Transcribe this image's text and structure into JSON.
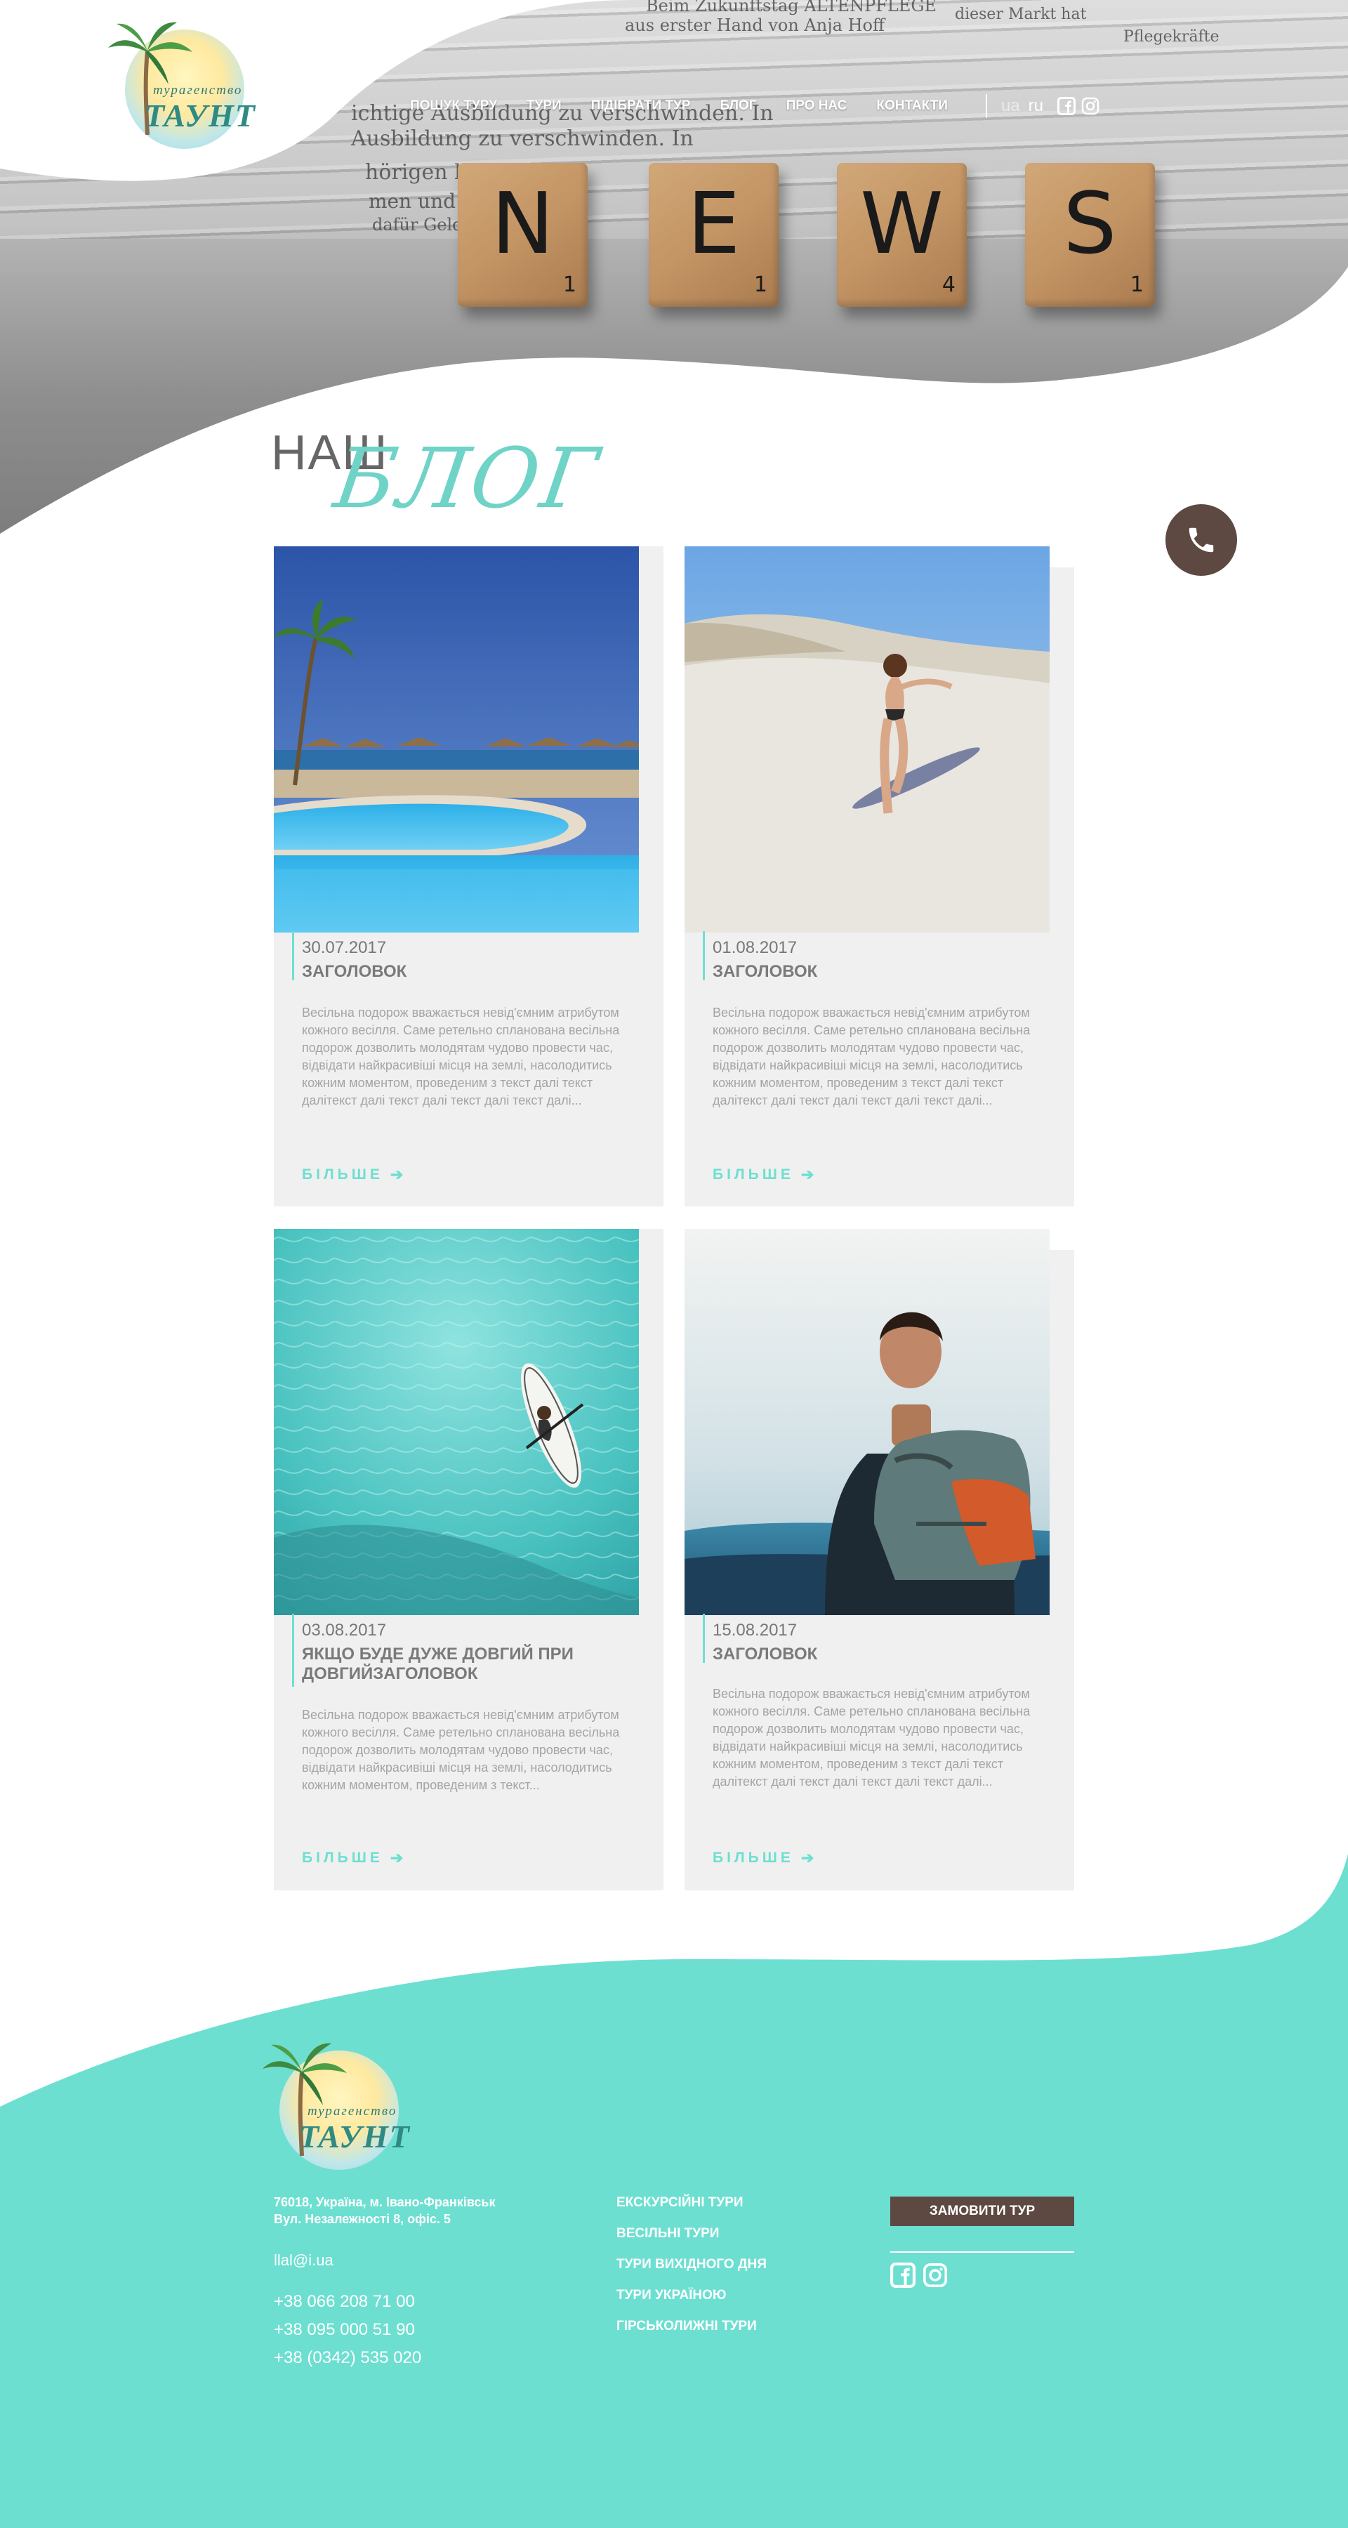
{
  "brand": {
    "logo_small_text": "турагенство",
    "logo_name": "ТАУНТ",
    "accent_color": "#6ddfd1",
    "dark_color": "#5e4942"
  },
  "nav": {
    "items": [
      {
        "label": "ПОШУК ТУРУ"
      },
      {
        "label": "ТУРИ"
      },
      {
        "label": "ПІДІБРАТИ ТУР"
      },
      {
        "label": "БЛОГ"
      },
      {
        "label": "ПРО НАС"
      },
      {
        "label": "КОНТАКТИ"
      }
    ],
    "lang_ua": "ua",
    "lang_ru": "ru",
    "icons": [
      "facebook-icon",
      "instagram-icon"
    ]
  },
  "hero": {
    "tiles": [
      {
        "letter": "N",
        "score": "1"
      },
      {
        "letter": "E",
        "score": "1"
      },
      {
        "letter": "W",
        "score": "4"
      },
      {
        "letter": "S",
        "score": "1"
      }
    ],
    "paper_lines": [
      "Beim Zukunftstag ALTENPFLEGE",
      "aus erster Hand von Anja Hoff",
      "dieser Markt hat",
      "Pflegekräfte",
      "ichtige Ausbildung zu verschwinden. In",
      "Ausbildung zu verschwinden. In",
      "hörigen belasten",
      "men und Ausbildung",
      "dafür Geld Prüfungen"
    ]
  },
  "blog": {
    "title_part1": "НАШ",
    "title_part2": "БЛОГ",
    "more_label": "БІЛЬШЕ",
    "posts": [
      {
        "date": "30.07.2017",
        "title": "ЗАГОЛОВОК",
        "text": "Весільна подорож вважається невід'ємним атрибутом кожного весілля. Саме ретельно спланована весільна подорож дозволить молодятам чудово провести час, відвідати найкрасивіші місця на землі, насолодитись кожним моментом, проведеним з текст далі  текст далітекст далі  текст далі  текст далі  текст далі...",
        "image": "pool-resort"
      },
      {
        "date": "01.08.2017",
        "title": "ЗАГОЛОВОК",
        "text": "Весільна подорож вважається невід'ємним атрибутом кожного весілля. Саме ретельно спланована весільна подорож дозволить молодятам чудово провести час, відвідати найкрасивіші місця на землі, насолодитись кожним моментом, проведеним з текст далі  текст далітекст далі  текст далі  текст далі  текст далі...",
        "image": "beach-walk"
      },
      {
        "date": "03.08.2017",
        "title": "ЯКЩО БУДЕ ДУЖЕ ДОВГИЙ ПРИ ДОВГИЙЗАГОЛОВОК",
        "text": "Весільна подорож вважається невід'ємним атрибутом кожного весілля. Саме ретельно спланована весільна подорож дозволить молодятам чудово провести час, відвідати найкрасивіші місця на землі, насолодитись кожним моментом, проведеним з текст...",
        "image": "paddle-board"
      },
      {
        "date": "15.08.2017",
        "title": "ЗАГОЛОВОК",
        "text": "Весільна подорож вважається невід'ємним атрибутом кожного весілля. Саме ретельно спланована весільна подорож дозволить молодятам чудово провести час, відвідати найкрасивіші місця на землі, насолодитись кожним моментом, проведеним з текст далі  текст далітекст далі  текст далі  текст далі  текст далі...",
        "image": "hiker"
      }
    ]
  },
  "footer": {
    "address_line1": "76018, Україна, м. Івано-Франківськ",
    "address_line2": "Вул. Незалежності 8, офіс. 5",
    "email": "llal@i.ua",
    "phones": [
      "+38 066 208 71 00",
      "+38 095 000 51 90",
      "+38 (0342) 535 020"
    ],
    "links": [
      {
        "label": "ЕКСКУРСІЙНІ ТУРИ"
      },
      {
        "label": "ВЕСІЛЬНІ ТУРИ"
      },
      {
        "label": "ТУРИ ВИХІДНОГО ДНЯ"
      },
      {
        "label": "ТУРИ УКРАЇНОЮ"
      },
      {
        "label": "ГІРСЬКОЛИЖНІ ТУРИ"
      }
    ],
    "order_button": "ЗАМОВИТИ ТУР",
    "icons": [
      "facebook-icon",
      "instagram-icon"
    ]
  }
}
